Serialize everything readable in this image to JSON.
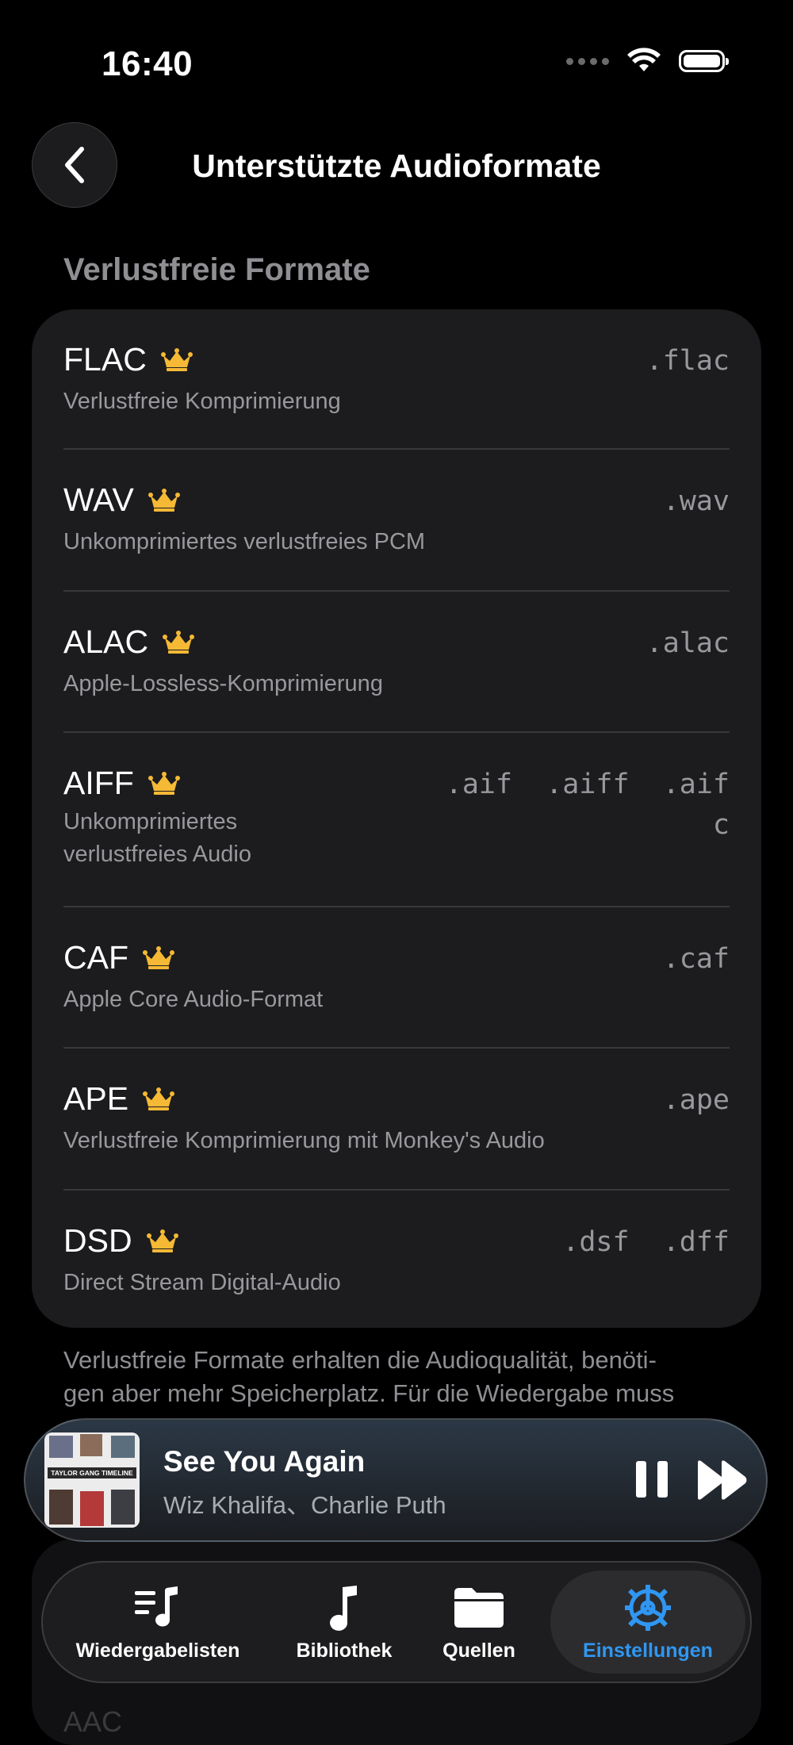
{
  "status": {
    "time": "16:40"
  },
  "header": {
    "title": "Unterstützte Audioformate"
  },
  "section": {
    "title": "Verlustfreie Formate"
  },
  "formats": [
    {
      "name": "FLAC",
      "desc": "Verlustfreie Komprimierung",
      "ext": ".flac"
    },
    {
      "name": "WAV",
      "desc": "Unkomprimiertes verlustfreies PCM",
      "ext": ".wav"
    },
    {
      "name": "ALAC",
      "desc": "Apple-Lossless-Komprimierung",
      "ext": ".alac"
    },
    {
      "name": "AIFF",
      "desc_line1": "Unkomprimiertes",
      "desc_line2": "verlustfreies Audio",
      "ext": ".aif  .aiff  .aif",
      "ext_wrap": "c"
    },
    {
      "name": "CAF",
      "desc": "Apple Core Audio-Format",
      "ext": ".caf"
    },
    {
      "name": "APE",
      "desc": "Verlustfreie Komprimierung mit Monkey's Audio",
      "ext": ".ape"
    },
    {
      "name": "DSD",
      "desc": "Direct Stream Digital-Audio",
      "ext": ".dsf  .dff"
    }
  ],
  "footer": {
    "line1": "Verlustfreie Formate erhalten die Audioqualität, benöti-",
    "line2": "gen aber mehr Speicherplatz. Für die Wiedergabe muss"
  },
  "player": {
    "title": "See You Again",
    "artist": "Wiz Khalifa、Charlie Puth",
    "album_art_text": "TAYLOR GANG TIMELINE"
  },
  "behind_text": "AAC",
  "tabs": [
    {
      "label": "Wiedergabelisten",
      "icon": "playlist-icon"
    },
    {
      "label": "Bibliothek",
      "icon": "music-note-icon"
    },
    {
      "label": "Quellen",
      "icon": "folder-icon"
    },
    {
      "label": "Einstellungen",
      "icon": "gear-icon",
      "active": true
    }
  ],
  "colors": {
    "accent": "#2f97f2",
    "crown": "#f5b935",
    "card": "#1c1c1e"
  }
}
